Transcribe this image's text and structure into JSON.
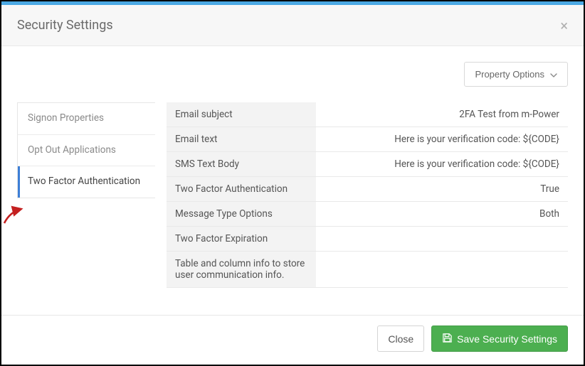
{
  "header": {
    "title": "Security Settings",
    "close_glyph": "×"
  },
  "property_options_label": "Property Options",
  "tabs": {
    "t0": {
      "label": "Signon Properties"
    },
    "t1": {
      "label": "Opt Out Applications"
    },
    "t2": {
      "label": "Two Factor Authentication"
    }
  },
  "settings": {
    "r0": {
      "key": "Email subject",
      "val": "2FA Test from m-Power"
    },
    "r1": {
      "key": "Email text",
      "val": "Here is your verification code: ${CODE}"
    },
    "r2": {
      "key": "SMS Text Body",
      "val": "Here is your verification code: ${CODE}"
    },
    "r3": {
      "key": "Two Factor Authentication",
      "val": "True"
    },
    "r4": {
      "key": "Message Type Options",
      "val": "Both"
    },
    "r5": {
      "key": "Two Factor Expiration",
      "val": ""
    },
    "r6": {
      "key": "Table and column info to store user communication info.",
      "val": ""
    }
  },
  "footer": {
    "close_label": "Close",
    "save_label": "Save Security Settings"
  },
  "colors": {
    "topbar": "#4ba9e4",
    "success": "#4CAF50",
    "active_tab": "#3d7fd6",
    "arrow": "#c42020"
  }
}
